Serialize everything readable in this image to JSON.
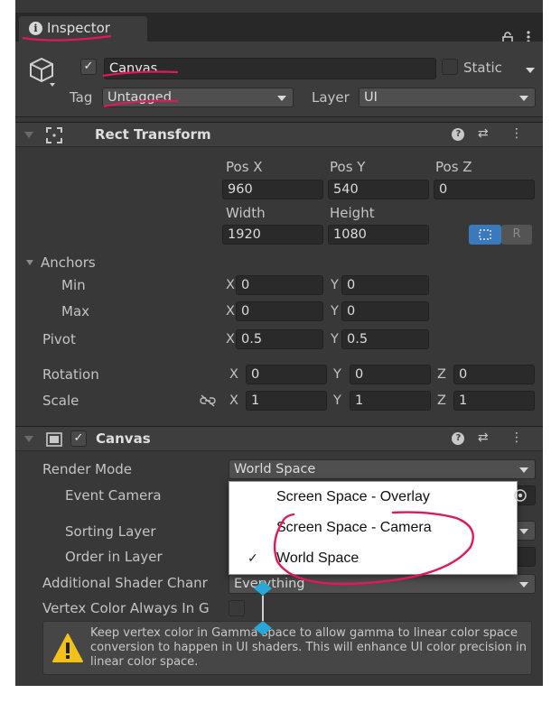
{
  "tab": {
    "label": "Inspector"
  },
  "header": {
    "object_name": "Canvas",
    "static_label": "Static",
    "tag_label": "Tag",
    "tag_value": "Untagged",
    "layer_label": "Layer",
    "layer_value": "UI"
  },
  "rect_transform": {
    "title": "Rect Transform",
    "pos_x_label": "Pos X",
    "pos_y_label": "Pos Y",
    "pos_z_label": "Pos Z",
    "pos_x": "960",
    "pos_y": "540",
    "pos_z": "0",
    "width_label": "Width",
    "height_label": "Height",
    "width": "1920",
    "height": "1080",
    "raw_button": "R",
    "anchors_label": "Anchors",
    "min_label": "Min",
    "max_label": "Max",
    "pivot_label": "Pivot",
    "x_label": "X",
    "y_label": "Y",
    "z_label": "Z",
    "min_x": "0",
    "min_y": "0",
    "max_x": "0",
    "max_y": "0",
    "pivot_x": "0.5",
    "pivot_y": "0.5",
    "rotation_label": "Rotation",
    "rot_x": "0",
    "rot_y": "0",
    "rot_z": "0",
    "scale_label": "Scale",
    "scale_x": "1",
    "scale_y": "1",
    "scale_z": "1"
  },
  "canvas": {
    "title": "Canvas",
    "render_mode_label": "Render Mode",
    "render_mode_value": "World Space",
    "event_camera_label": "Event Camera",
    "sorting_layer_label": "Sorting Layer",
    "order_in_layer_label": "Order in Layer",
    "additional_shader_label": "Additional Shader Chanr",
    "additional_shader_value": "Everything",
    "vertex_color_label": "Vertex Color Always In G",
    "warning_text": "Keep vertex color in Gamma space to allow gamma to linear color space conversion to happen in UI shaders. This will enhance UI color precision in linear color space."
  },
  "render_mode_menu": {
    "options": [
      "Screen Space - Overlay",
      "Screen Space - Camera",
      "World Space"
    ],
    "selected": "World Space"
  },
  "colors": {
    "panel_bg": "#383838",
    "field_bg": "#2a2a2a",
    "annotation": "#e0195a",
    "selection_blue": "#3a79bb"
  },
  "icons": [
    "info-icon",
    "lock-icon",
    "kebab-menu-icon",
    "cube-icon",
    "help-icon",
    "preset-icon",
    "rect-tool-icon",
    "blueprint-icon",
    "link-icon",
    "target-icon",
    "warning-icon"
  ]
}
